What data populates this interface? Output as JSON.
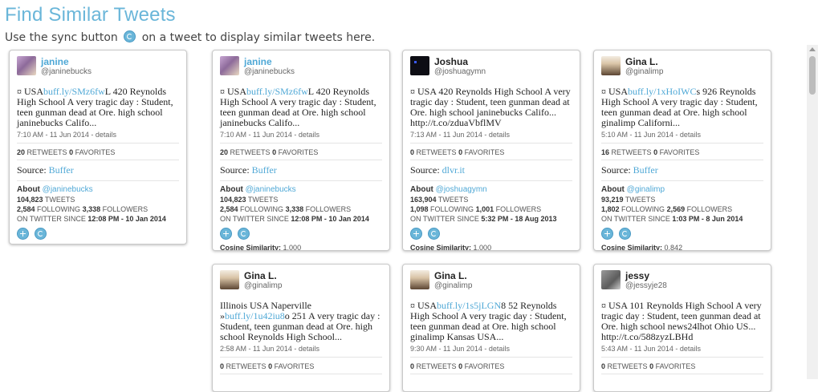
{
  "page": {
    "title": "Find Similar Tweets",
    "subtitle_before": "Use the sync button",
    "subtitle_after": "on a tweet to display similar tweets here."
  },
  "labels": {
    "retweets": "RETWEETS",
    "favorites": "FAVORITES",
    "source": "Source:",
    "about": "About",
    "tweets": "TWEETS",
    "following": "FOLLOWING",
    "followers": "FOLLOWERS",
    "on_twitter_since": "ON TWITTER SINCE",
    "cosine": "Cosine Similarity:",
    "details": "details"
  },
  "cards": {
    "c1": {
      "name": "janine",
      "handle": "@janinebucks",
      "text_prefix": "¤ USA",
      "link": "buff.ly/SMz6fw",
      "text_suffix": "L 420 Reynolds High School A very tragic day : Student, teen gunman dead at Ore. high school janinebucks Califo...",
      "timestamp": "7:10 AM - 11 Jun 2014 -",
      "retweets": "20",
      "favorites": "0",
      "source": "Buffer",
      "about_handle": "@janinebucks",
      "tweets": "104,823",
      "following": "2,584",
      "followers": "3,338",
      "since": "12:08 PM - 10 Jan 2014"
    },
    "c2": {
      "name": "janine",
      "handle": "@janinebucks",
      "text_prefix": "¤ USA",
      "link": "buff.ly/SMz6fw",
      "text_suffix": "L 420 Reynolds High School A very tragic day : Student, teen gunman dead at Ore. high school janinebucks Califo...",
      "timestamp": "7:10 AM - 11 Jun 2014 -",
      "retweets": "20",
      "favorites": "0",
      "source": "Buffer",
      "about_handle": "@janinebucks",
      "tweets": "104,823",
      "following": "2,584",
      "followers": "3,338",
      "since": "12:08 PM - 10 Jan 2014",
      "cosine": "1.000"
    },
    "c3": {
      "name": "Joshua",
      "handle": "@joshuagymn",
      "text": "¤ USA 420 Reynolds High School A very tragic day : Student, teen gunman dead at Ore. high school janinebucks Califo... http://t.co/zduaVbflMV",
      "timestamp": "7:13 AM - 11 Jun 2014 -",
      "retweets": "0",
      "favorites": "0",
      "source": "dlvr.it",
      "about_handle": "@joshuagymn",
      "tweets": "163,904",
      "following": "1,098",
      "followers": "1,001",
      "since": "5:32 PM - 18 Aug 2013",
      "cosine": "1.000"
    },
    "c4": {
      "name": "Gina L.",
      "handle": "@ginalimp",
      "text_prefix": "¤ USA",
      "link": "buff.ly/1xHoIWC",
      "text_suffix": "s 926 Reynolds High School A very tragic day : Student, teen gunman dead at Ore. high school ginalimp Californi...",
      "timestamp": "5:10 AM - 11 Jun 2014 -",
      "retweets": "16",
      "favorites": "0",
      "source": "Buffer",
      "about_handle": "@ginalimp",
      "tweets": "93,219",
      "following": "1,802",
      "followers": "2,569",
      "since": "1:03 PM - 8 Jun 2014",
      "cosine": "0.842"
    },
    "c5": {
      "name": "Gina L.",
      "handle": "@ginalimp",
      "text_prefix": "Illinois USA Naperville »",
      "link": "buff.ly/1u42iu8",
      "text_suffix": "o 251 A very tragic day : Student, teen gunman dead at Ore. high school Reynolds High School...",
      "timestamp": "2:58 AM - 11 Jun 2014 -",
      "retweets": "0",
      "favorites": "0"
    },
    "c6": {
      "name": "Gina L.",
      "handle": "@ginalimp",
      "text_prefix": "¤ USA",
      "link": "buff.ly/1s5jLGN",
      "text_suffix": "8 52 Reynolds High School A very tragic day : Student, teen gunman dead at Ore. high school ginalimp Kansas USA...",
      "timestamp": "9:30 AM - 11 Jun 2014 -",
      "retweets": "0",
      "favorites": "0"
    },
    "c7": {
      "name": "jessy",
      "handle": "@jessyje28",
      "text": "¤ USA 101 Reynolds High School A very tragic day : Student, teen gunman dead at Ore. high school news24lhot Ohio US... http://t.co/588zyzLBHd",
      "timestamp": "5:43 AM - 11 Jun 2014 -",
      "retweets": "0",
      "favorites": "0"
    }
  }
}
